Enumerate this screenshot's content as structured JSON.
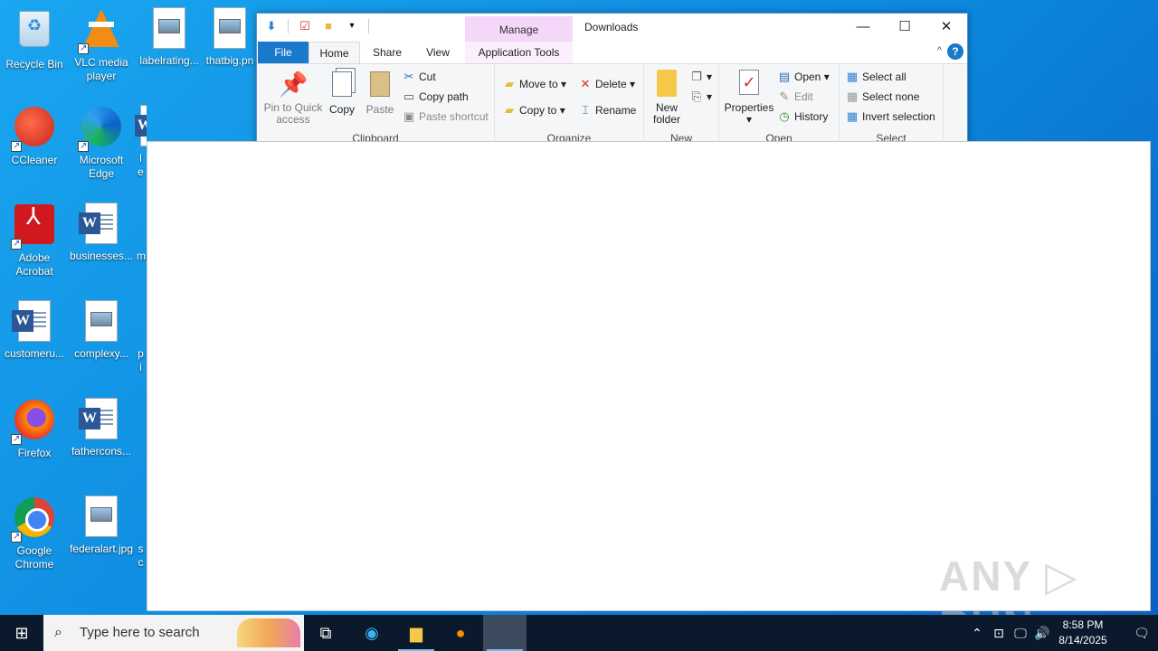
{
  "desktop": {
    "icons": [
      {
        "label": "Recycle Bin",
        "icon": "recycle-bin-icon"
      },
      {
        "label": "VLC media player",
        "icon": "vlc-icon"
      },
      {
        "label": "labelrating...",
        "icon": "image-file-icon"
      },
      {
        "label": "thatbig.pn",
        "icon": "image-file-icon"
      },
      {
        "label": "CCleaner",
        "icon": "ccleaner-icon"
      },
      {
        "label": "Microsoft Edge",
        "icon": "edge-icon"
      },
      {
        "label": "le",
        "icon": "word-file-icon"
      },
      {
        "label": "Adobe Acrobat",
        "icon": "acrobat-icon"
      },
      {
        "label": "businesses...",
        "icon": "word-file-icon"
      },
      {
        "label": "m",
        "icon": "file-icon"
      },
      {
        "label": "customeru...",
        "icon": "word-file-icon"
      },
      {
        "label": "complexy...",
        "icon": "image-file-icon"
      },
      {
        "label": "pi",
        "icon": "file-icon"
      },
      {
        "label": "Firefox",
        "icon": "firefox-icon"
      },
      {
        "label": "fathercons...",
        "icon": "word-file-icon"
      },
      {
        "label": "Google Chrome",
        "icon": "chrome-icon"
      },
      {
        "label": "federalart.jpg",
        "icon": "image-file-icon"
      },
      {
        "label": "sc",
        "icon": "file-icon"
      }
    ]
  },
  "explorer": {
    "title": "Downloads",
    "contextual_tab": "Manage",
    "tabs": {
      "file": "File",
      "home": "Home",
      "share": "Share",
      "view": "View",
      "app_tools": "Application Tools"
    },
    "controls": {
      "minimize": "—",
      "maximize": "☐",
      "close": "✕",
      "help": "?",
      "collapse": "^"
    },
    "ribbon": {
      "clipboard": {
        "label": "Clipboard",
        "pin": "Pin to Quick access",
        "copy": "Copy",
        "paste": "Paste",
        "cut": "Cut",
        "copy_path": "Copy path",
        "paste_shortcut": "Paste shortcut"
      },
      "organize": {
        "label": "Organize",
        "move_to": "Move to",
        "copy_to": "Copy to",
        "delete": "Delete",
        "rename": "Rename"
      },
      "new": {
        "label": "New",
        "new_folder": "New folder"
      },
      "open": {
        "label": "Open",
        "properties": "Properties",
        "open": "Open",
        "edit": "Edit",
        "history": "History"
      },
      "select": {
        "label": "Select",
        "select_all": "Select all",
        "select_none": "Select none",
        "invert": "Invert selection"
      }
    }
  },
  "watermark": "ANY ▷ RUN",
  "taskbar": {
    "search_placeholder": "Type here to search",
    "time": "8:58 PM",
    "date": "8/14/2025"
  }
}
